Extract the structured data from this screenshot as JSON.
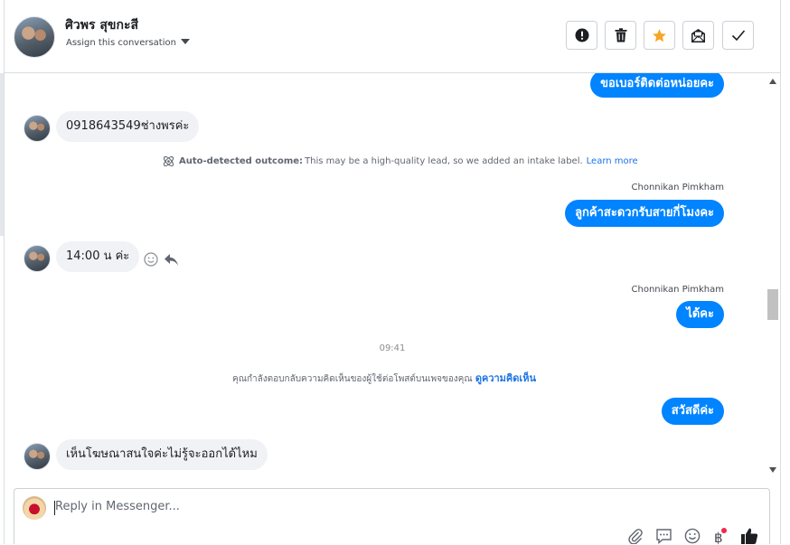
{
  "header": {
    "contact_name": "ศิวพร สุขกะสี",
    "assign_label": "Assign this conversation",
    "buttons": [
      {
        "name": "spam-button",
        "icon": "exclamation-circle-icon"
      },
      {
        "name": "delete-button",
        "icon": "trash-icon"
      },
      {
        "name": "star-button",
        "icon": "star-icon",
        "color": "#f5a623"
      },
      {
        "name": "mark-unread-button",
        "icon": "envelope-icon"
      },
      {
        "name": "done-button",
        "icon": "checkmark-icon"
      }
    ]
  },
  "messages": {
    "m1": "ขอเบอร์ติดต่อหน่อยคะ",
    "m2": "0918643549ช่างพรค่ะ",
    "outcome_label": "Auto-detected outcome:",
    "outcome_text": " This may be a high-quality lead, so we added an intake label.",
    "outcome_link": "Learn more",
    "sender1": "Chonnikan Pimkham",
    "m3": "ลูกค้าสะดวกรับสายกี่โมงคะ",
    "m4": "14:00 น ค่ะ",
    "sender2": "Chonnikan Pimkham",
    "m5": "ได้คะ",
    "timestamp": "09:41",
    "reply_note": "คุณกำลังตอบกลับความคิดเห็นของผู้ใช้ต่อโพสต์บนเพจของคุณ",
    "reply_note_link": "ดูความคิดเห็น",
    "m6": "สวัสดีค่ะ",
    "m7": "เห็นโฆษณาสนใจค่ะไม่รู้จะออกได้ไหม"
  },
  "composer": {
    "placeholder": "Reply in Messenger...",
    "tools": [
      "paperclip-icon",
      "saved-reply-icon",
      "emoji-icon",
      "baht-icon",
      "thumbs-up-icon"
    ]
  },
  "colors": {
    "outgoing_bubble": "#0084ff",
    "incoming_bubble": "#f0f2f5",
    "link": "#1b74e4"
  }
}
